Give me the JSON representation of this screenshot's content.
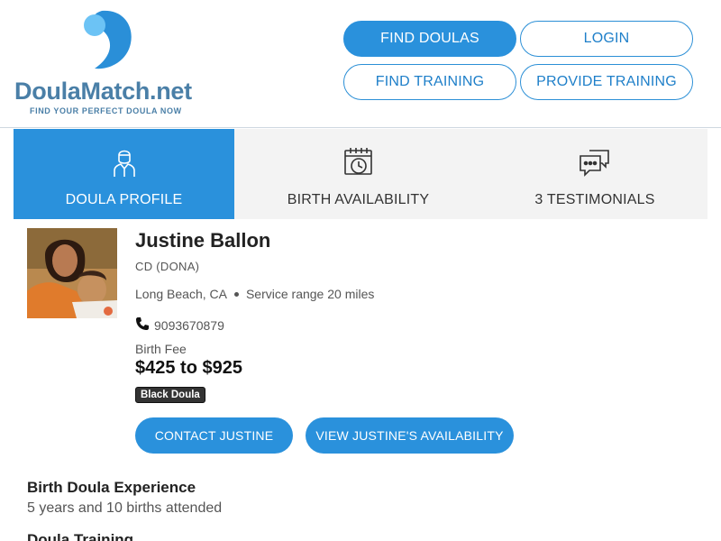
{
  "brand": {
    "name_part1": "Doula",
    "name_part2": "Match",
    "name_part3": ".net",
    "tagline": "FIND YOUR PERFECT DOULA NOW",
    "color": "#4a7fa7",
    "accent": "#2a91dc"
  },
  "nav": {
    "find_doulas": "FIND DOULAS",
    "login": "LOGIN",
    "find_training": "FIND TRAINING",
    "provide_training": "PROVIDE TRAINING"
  },
  "tabs": [
    {
      "label": "DOULA PROFILE",
      "icon": "person-icon",
      "active": true
    },
    {
      "label": "BIRTH AVAILABILITY",
      "icon": "calendar-clock-icon",
      "active": false
    },
    {
      "label": "3 TESTIMONIALS",
      "icon": "chat-bubbles-icon",
      "active": false
    }
  ],
  "profile": {
    "name": "Justine Ballon",
    "credentials": "CD (DONA)",
    "location": "Long Beach, CA",
    "service_range": "Service range 20 miles",
    "phone": "9093670879",
    "fee_label": "Birth Fee",
    "fee": "$425 to $925",
    "badge": "Black Doula",
    "contact_button": "CONTACT JUSTINE",
    "availability_button": "VIEW JUSTINE'S AVAILABILITY"
  },
  "sections": {
    "experience_heading": "Birth Doula Experience",
    "experience_text": "5 years and 10 births attended",
    "training_heading": "Doula Training"
  }
}
